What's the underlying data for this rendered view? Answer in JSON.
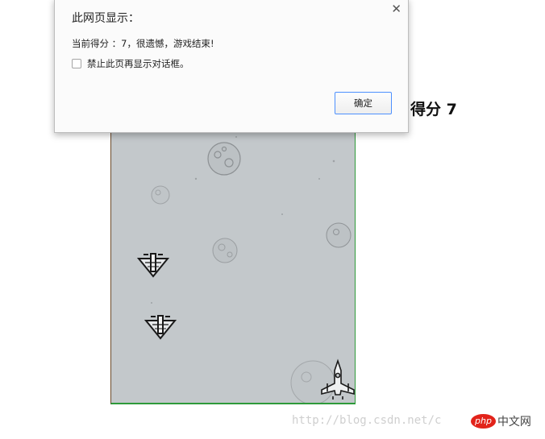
{
  "dialog": {
    "title": "此网页显示：",
    "message": "当前得分 ：7，很遗憾，游戏结束!",
    "checkbox_label": "禁止此页再显示对话框。",
    "checkbox_checked": false,
    "ok_label": "确定",
    "close_icon": "close-icon"
  },
  "game": {
    "score_label": "得分 7",
    "background_color": "#c3c8cb",
    "enemy_count": 2,
    "player_plane": "player-plane-icon",
    "enemy_plane": "enemy-plane-icon"
  },
  "watermark": {
    "url_text": "http://blog.csdn.net/c",
    "logo_php": "php",
    "logo_cn": "中文网"
  }
}
